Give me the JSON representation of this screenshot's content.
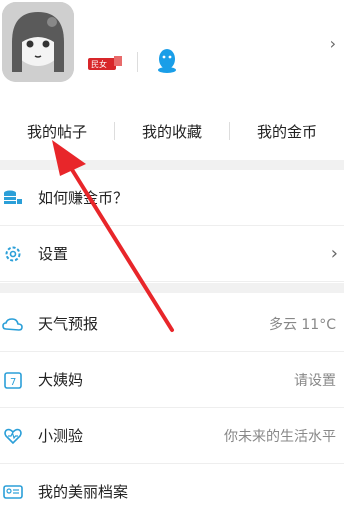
{
  "profile": {
    "level_badge": "民女",
    "chevron": "›"
  },
  "tabs": [
    {
      "label": "我的帖子"
    },
    {
      "label": "我的收藏"
    },
    {
      "label": "我的金币"
    }
  ],
  "menu": {
    "earn_coins": {
      "label": "如何赚金币？",
      "icon": "coin-stack-icon"
    },
    "settings": {
      "label": "设置",
      "icon": "gear-icon",
      "chevron": "›"
    },
    "weather": {
      "label": "天气预报",
      "value": "多云 11°C",
      "icon": "cloud-sun-icon"
    },
    "period": {
      "label": "大姨妈",
      "value": "请设置",
      "icon": "calendar-7-icon"
    },
    "quiz": {
      "label": "小测验",
      "value": "你未来的生活水平",
      "icon": "heart-pulse-icon"
    },
    "profile_file": {
      "label": "我的美丽档案",
      "icon": "id-card-icon"
    }
  },
  "colors": {
    "accent": "#2b9fd8",
    "arrow": "#e8262a",
    "badge": "#d8262a",
    "qq": "#1a9ee8"
  }
}
